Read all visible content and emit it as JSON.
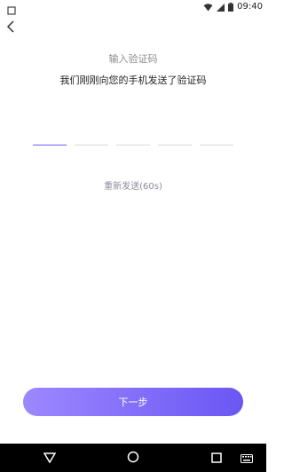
{
  "status_bar": {
    "time": "09:40",
    "icons": [
      "notification-square-icon",
      "wifi-icon",
      "signal-icon",
      "battery-icon"
    ]
  },
  "header": {
    "back_icon": "back-icon",
    "title": "输入验证码",
    "subtitle": "我们刚刚向您的手机发送了验证码"
  },
  "code_input": {
    "slots": [
      "",
      "",
      "",
      "",
      ""
    ],
    "active_slot_index": 0,
    "colors": {
      "active": "#6a5df3",
      "inactive": "#dadada"
    }
  },
  "resend": {
    "label": "重新发送(60s)"
  },
  "actions": {
    "next_label": "下一步",
    "colors": {
      "gradient_start": "#9d88ff",
      "gradient_end": "#6a56f3"
    }
  },
  "nav_bar": {
    "icons": [
      "nav-back-icon",
      "nav-home-icon",
      "nav-recents-icon",
      "keyboard-icon"
    ]
  }
}
